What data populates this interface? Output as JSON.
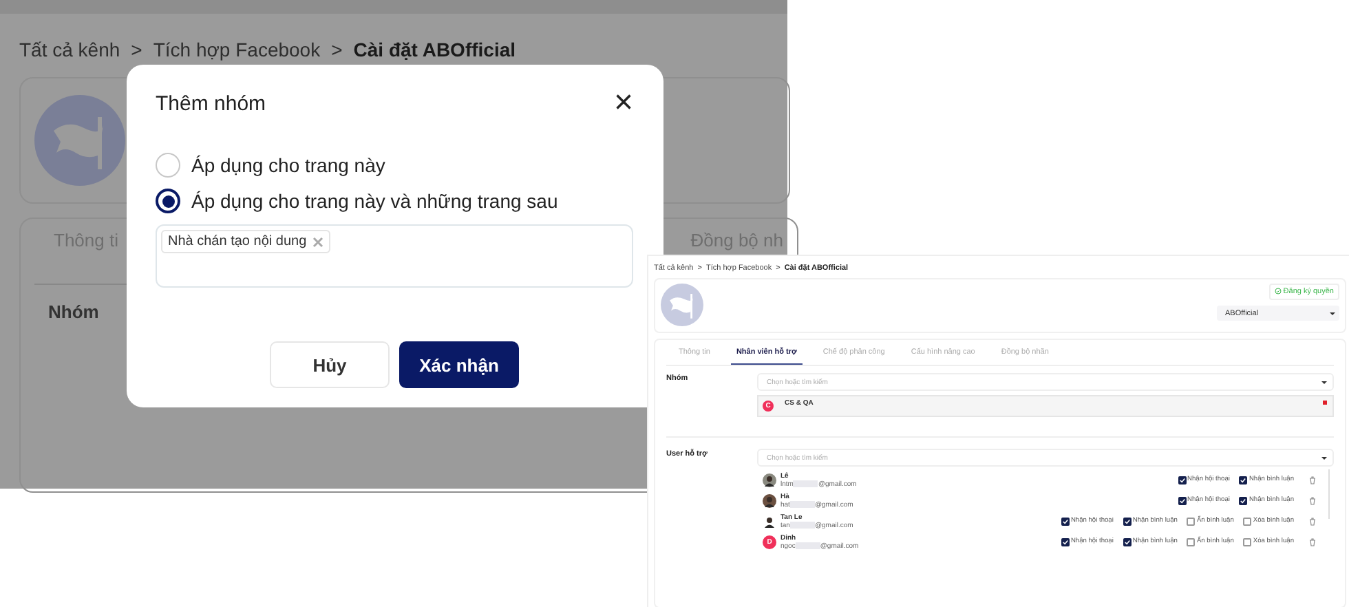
{
  "background_page": {
    "breadcrumb": [
      {
        "label": "Tất cả kênh",
        "current": false
      },
      {
        "label": "Tích hợp Facebook",
        "current": false
      },
      {
        "label": "Cài đặt ABOfficial",
        "current": true
      }
    ],
    "separator": ">",
    "tabs": [
      "Thông ti",
      "Đồng bộ nh"
    ],
    "group_label": "Nhóm"
  },
  "modal": {
    "title": "Thêm nhóm",
    "close": "×",
    "options": [
      {
        "label": "Áp dụng cho trang này",
        "selected": false
      },
      {
        "label": "Áp dụng cho trang này và những trang sau",
        "selected": true
      }
    ],
    "tags": [
      {
        "label": "Nhà chán tạo nội dung"
      }
    ],
    "buttons": [
      {
        "label": "Hủy",
        "kind": "secondary"
      },
      {
        "label": "Xác nhận",
        "kind": "primary"
      }
    ]
  },
  "inset": {
    "breadcrumb": [
      {
        "label": "Tất cả kênh",
        "current": false
      },
      {
        "label": "Tích hợp Facebook",
        "current": false
      },
      {
        "label": "Cài đặt ABOfficial",
        "current": true
      }
    ],
    "separator": ">",
    "register_button": "Đăng ký quyền",
    "page_select": "ABOfficial",
    "tabs": [
      {
        "label": "Thông tin",
        "selected": false
      },
      {
        "label": "Nhân viên hỗ trợ",
        "selected": true
      },
      {
        "label": "Chế độ phân công",
        "selected": false
      },
      {
        "label": "Cấu hình nâng cao",
        "selected": false
      },
      {
        "label": "Đồng bộ nhãn",
        "selected": false
      }
    ],
    "group": {
      "label": "Nhóm",
      "placeholder": "Chọn hoặc tìm kiếm",
      "items": [
        {
          "initial": "C",
          "name": "CS & QA",
          "color": "#f0305a"
        }
      ]
    },
    "users": {
      "label": "User hỗ trợ",
      "placeholder": "Chọn hoặc tìm kiếm",
      "items": [
        {
          "name": "Lê",
          "email_start": "lntm",
          "email_end": "@gmail.com",
          "kind": "photo",
          "permissions": [
            {
              "label": "Nhận hội thoại",
              "checked": true
            },
            {
              "label": "Nhận bình luận",
              "checked": true
            }
          ]
        },
        {
          "name": "Hà",
          "email_start": "hat",
          "email_end": "@gmail.com",
          "kind": "photo",
          "permissions": [
            {
              "label": "Nhận hội thoại",
              "checked": true
            },
            {
              "label": "Nhận bình luận",
              "checked": true
            }
          ]
        },
        {
          "name": "Tan Le",
          "email_start": "tan",
          "email_end": "@gmail.com",
          "kind": "photo",
          "permissions": [
            {
              "label": "Nhận hội thoại",
              "checked": true
            },
            {
              "label": "Nhận bình luận",
              "checked": true
            },
            {
              "label": "Ẩn bình luận",
              "checked": false
            },
            {
              "label": "Xóa bình luận",
              "checked": false
            }
          ]
        },
        {
          "name": "Dinh",
          "email_start": "ngoc",
          "email_end": "@gmail.com",
          "kind": "letter",
          "initial": "D",
          "permissions": [
            {
              "label": "Nhận hội thoại",
              "checked": true
            },
            {
              "label": "Nhận bình luận",
              "checked": true
            },
            {
              "label": "Ẩn bình luận",
              "checked": false
            },
            {
              "label": "Xóa bình luận",
              "checked": false
            }
          ]
        }
      ]
    }
  }
}
